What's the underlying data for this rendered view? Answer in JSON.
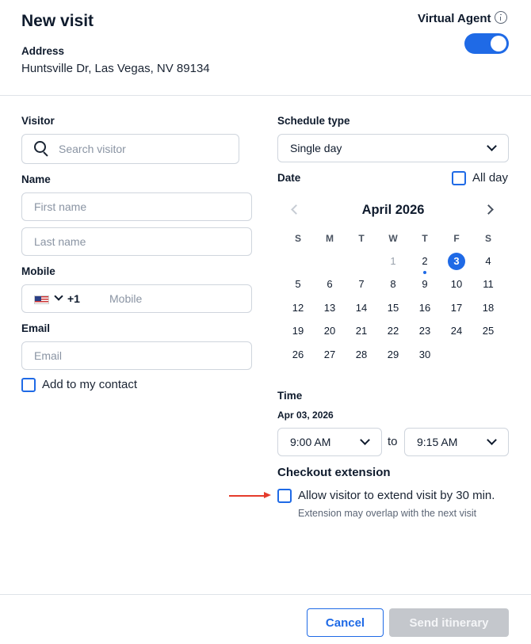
{
  "header": {
    "title": "New visit",
    "address_label": "Address",
    "address_value": "Huntsville Dr, Las Vegas, NV 89134",
    "virtual_agent_label": "Virtual Agent",
    "virtual_agent_on": true
  },
  "visitor": {
    "label": "Visitor",
    "search_placeholder": "Search visitor"
  },
  "name": {
    "label": "Name",
    "first_placeholder": "First name",
    "last_placeholder": "Last name"
  },
  "mobile": {
    "label": "Mobile",
    "country_code": "+1",
    "placeholder": "Mobile"
  },
  "email": {
    "label": "Email",
    "placeholder": "Email"
  },
  "contact": {
    "label": "Add to my contact",
    "checked": false
  },
  "schedule": {
    "label": "Schedule type",
    "value": "Single day"
  },
  "date": {
    "label": "Date",
    "all_day_label": "All day",
    "all_day_checked": false
  },
  "calendar": {
    "month_label": "April 2026",
    "weekdays": [
      "S",
      "M",
      "T",
      "W",
      "T",
      "F",
      "S"
    ],
    "weeks": [
      [
        "",
        "",
        "",
        "1",
        "2",
        "3",
        "4"
      ],
      [
        "5",
        "6",
        "7",
        "8",
        "9",
        "10",
        "11"
      ],
      [
        "12",
        "13",
        "14",
        "15",
        "16",
        "17",
        "18"
      ],
      [
        "19",
        "20",
        "21",
        "22",
        "23",
        "24",
        "25"
      ],
      [
        "26",
        "27",
        "28",
        "29",
        "30",
        "",
        ""
      ]
    ],
    "selected_day": "3",
    "today_day": "2",
    "disabled_days": [
      "1"
    ]
  },
  "time": {
    "label": "Time",
    "date_text": "Apr 03, 2026",
    "start": "9:00 AM",
    "to_label": "to",
    "end": "9:15 AM"
  },
  "checkout": {
    "label": "Checkout extension",
    "option_label": "Allow visitor to extend visit by 30 min.",
    "option_checked": false,
    "note": "Extension may overlap with the next visit"
  },
  "footer": {
    "cancel_label": "Cancel",
    "send_label": "Send itinerary"
  },
  "colors": {
    "accent": "#1f6ae6",
    "annotation_arrow": "#e53b2c",
    "disabled_button": "#c4c7cc"
  }
}
